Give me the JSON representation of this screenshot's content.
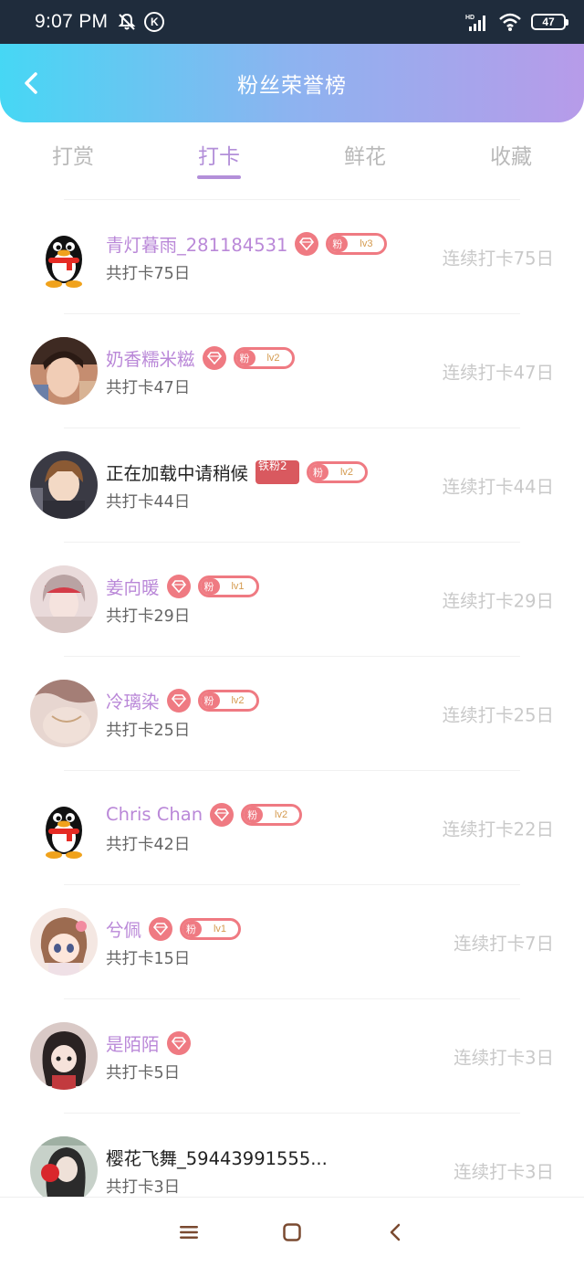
{
  "status_bar": {
    "time": "9:07 PM",
    "k_label": "K",
    "network": "HD",
    "battery": "47"
  },
  "header": {
    "title": "粉丝荣誉榜"
  },
  "tabs": [
    {
      "label": "打赏",
      "active": false
    },
    {
      "label": "打卡",
      "active": true
    },
    {
      "label": "鲜花",
      "active": false
    },
    {
      "label": "收藏",
      "active": false
    }
  ],
  "list": [
    {
      "name": "青灯暮雨_281184531",
      "total": "共打卡75日",
      "streak": "连续打卡75日",
      "fan_label": "粉",
      "level": "lv3"
    },
    {
      "name": "奶香糯米糍",
      "total": "共打卡47日",
      "streak": "连续打卡47日",
      "fan_label": "粉",
      "level": "lv2"
    },
    {
      "name": "正在加载中请稍候",
      "total": "共打卡44日",
      "streak": "连续打卡44日",
      "iron_badge": "铁粉2",
      "fan_label": "粉",
      "level": "lv2"
    },
    {
      "name": "姜向暖",
      "total": "共打卡29日",
      "streak": "连续打卡29日",
      "fan_label": "粉",
      "level": "lv1"
    },
    {
      "name": "冷璃染",
      "total": "共打卡25日",
      "streak": "连续打卡25日",
      "fan_label": "粉",
      "level": "lv2"
    },
    {
      "name": "Chris Chan",
      "total": "共打卡42日",
      "streak": "连续打卡22日",
      "fan_label": "粉",
      "level": "lv2"
    },
    {
      "name": "兮佩",
      "total": "共打卡15日",
      "streak": "连续打卡7日",
      "fan_label": "粉",
      "level": "lv1"
    },
    {
      "name": "是陌陌",
      "total": "共打卡5日",
      "streak": "连续打卡3日"
    },
    {
      "name": "樱花飞舞_59443991555...",
      "total": "共打卡3日",
      "streak": "连续打卡3日"
    }
  ],
  "colors": {
    "header_gradient_start": "#46d7f4",
    "header_gradient_end": "#b79be9",
    "active_tab": "#b38fd9",
    "name_purple": "#ba88d8",
    "badge_pink": "#ef7a82",
    "iron_badge_red": "#d9595f"
  },
  "icons": {
    "back": "chevron-left-icon",
    "gem": "diamond-icon",
    "nav_menu": "menu-icon",
    "nav_home": "square-home-icon",
    "nav_back": "back-arrow-icon"
  }
}
